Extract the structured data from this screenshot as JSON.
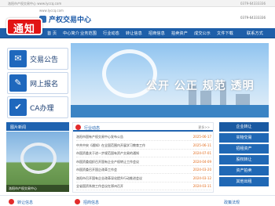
{
  "topbar": {
    "left_text": "洛阳市产权交易中心  www.lyccq.com",
    "right_text": "0379-64333336"
  },
  "header": {
    "url": "www.lyccq.com",
    "title": "产权交易中心",
    "hotline": "0379-64333336"
  },
  "nav": {
    "items": [
      {
        "label": "首 页"
      },
      {
        "label": "中心简介"
      },
      {
        "label": "业务范围"
      },
      {
        "label": "行业动态"
      },
      {
        "label": "转让信息"
      },
      {
        "label": "招商信息"
      },
      {
        "label": "拍卖资产"
      },
      {
        "label": "成交公示"
      },
      {
        "label": "文件下载"
      },
      {
        "label": "联系方式"
      }
    ]
  },
  "notice_badge": "通知",
  "side_buttons": [
    {
      "label": "交易公告",
      "icon": "megaphone-icon"
    },
    {
      "label": "网上报名",
      "icon": "form-icon"
    },
    {
      "label": "CA办理",
      "icon": "ca-cert-icon"
    }
  ],
  "banner": {
    "slogan": "公开 公正 规范 透明"
  },
  "photo_panel": {
    "title": "图片新闻",
    "caption": "洛阳市产权交易中心"
  },
  "news": {
    "title": "行业动态",
    "more": "更多>>",
    "items": [
      {
        "title": "洛阳市国有产权交易中心发布公告",
        "date": "2025-06-17"
      },
      {
        "title": "中共中央《通知》在全国范围内开展学习教育工作",
        "date": "2025-06-11"
      },
      {
        "title": "市国资委关于进一步规范国有资产交易的通知",
        "date": "2024-07-01"
      },
      {
        "title": "市国资委组织召开国有企业产权转让工作会议",
        "date": "2024-04-09"
      },
      {
        "title": "市国资委召开国企改革工作会",
        "date": "2024-03-20"
      },
      {
        "title": "洛阳市召开国有企业改革深化提升行动推进会议",
        "date": "2024-03-12"
      },
      {
        "title": "全省国资系统工作会议在郑州召开",
        "date": "2024-03-11"
      }
    ]
  },
  "right_col": {
    "items": [
      {
        "label": "企业转让"
      },
      {
        "label": "实物交易"
      },
      {
        "label": "招租资产"
      },
      {
        "label": "股权转让"
      },
      {
        "label": "资产拍卖"
      },
      {
        "label": "其他出租"
      }
    ]
  },
  "footer": {
    "left_title": "转让信息",
    "mid_title": "招商信息",
    "right_title": "政策法规"
  },
  "colors": {
    "primary": "#1f63b0",
    "nav": "#1e5fa9",
    "alert": "#e21414",
    "accent_date": "#e26a1a"
  }
}
